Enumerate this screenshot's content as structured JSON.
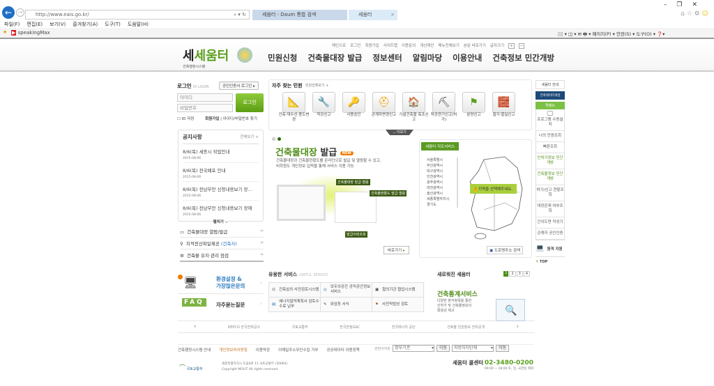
{
  "browser": {
    "url": "http://www.eais.go.kr/",
    "tabs": [
      "세움터 - Daum 통합 검색",
      "세움터"
    ],
    "menu": [
      "파일(F)",
      "편집(E)",
      "보기(V)",
      "즐겨찾기(A)",
      "도구(T)",
      "도움말(H)"
    ],
    "favorite": "speakingMax",
    "toolbar": [
      "페이지(P) ▾",
      "안전(S) ▾",
      "도구(O) ▾"
    ]
  },
  "header": {
    "logo": "세움터",
    "logo_sub": "건축행정시스템",
    "util": [
      "메인으로",
      "로그인",
      "회원가입",
      "사이트맵",
      "이용문의",
      "개선제안",
      "메뉴전체보기",
      "본문 바로가기",
      "글자크기"
    ],
    "nav": [
      "민원신청",
      "건축물대장 발급",
      "정보센터",
      "알림마당",
      "이용안내",
      "건축정보 민간개방"
    ]
  },
  "login": {
    "title": "로그인",
    "title_en": "ID LOGIN",
    "cert": "공인인증서 로그인",
    "id_ph": "아이디",
    "pw_ph": "비밀번호",
    "button": "로그인",
    "save_id": "ID 저장",
    "join": "회원가입",
    "find": "아이디/비밀번호 찾기"
  },
  "notice": {
    "title": "공지사항",
    "more": "전체보기 +",
    "items": [
      {
        "t": "8/6(목) 세종시 작업안내",
        "d": "2015-08-06"
      },
      {
        "t": "8/6(목) 전국배포 안내",
        "d": "2015-08-06"
      },
      {
        "t": "8/6(목) 전남무안 신청내용보기 장…",
        "d": "2015-08-06"
      },
      {
        "t": "8/6(목) 전남무안 신청내용보기 장애",
        "d": "2015-08-06"
      }
    ],
    "expand": "펼치기"
  },
  "quick_links": [
    "건축물대장 열람/발급",
    "지적전산파일제공",
    "건축물 유지·관리 점검"
  ],
  "quick_sub": "(건축사)",
  "promo": [
    {
      "t1": "환경설정 &",
      "t2": "가장많은문의"
    },
    {
      "t1": "자주묻는질문"
    }
  ],
  "frequent": {
    "title": "자주 찾는 민원",
    "more": "민원전체보기 +",
    "items": [
      "건축·대수선·용도변경",
      "착공신고",
      "사용승인",
      "관계자변경신고",
      "가설건축물 축조신고",
      "착공연기신고(허가)",
      "분양신고",
      "철거·멸실신고"
    ],
    "expand": "더보기"
  },
  "banner": {
    "title_g": "건축물대장",
    "title_b": "발급",
    "badge": "NEW",
    "desc1": "건축물대장과 건축물현황도를 온라인으로 발급 및 열람할 수 있고,",
    "desc2": "비회원도 개인정보 입력을 통해 서비스 이용 가능",
    "tags": [
      "건축물대장 발급·열람",
      "건축물현황도 발급·열람",
      "발급이력조회"
    ],
    "go": "바로가기"
  },
  "map": {
    "title": "세움터 지도서비스",
    "regions": [
      "서울특별시",
      "부산광역시",
      "대구광역시",
      "인천광역시",
      "광주광역시",
      "대전광역시",
      "울산광역시",
      "세종특별자치시",
      "경기도"
    ],
    "hint": "지역을 선택해주세요.",
    "road": "도로명주소 검색"
  },
  "side": {
    "title": "세움터 안내",
    "banner": "건축데이터개방",
    "quick": "퀵메뉴",
    "items": [
      "프로그램 수동설치",
      "나의 민원조회",
      "빠른조회",
      "인허가정보 민간개방",
      "건축물정보 민간개방",
      "허가/신고 현황조회",
      "대장존재 여부조회",
      "간이도면 작성기",
      "관계자 공인인증"
    ],
    "remote": "원격 지원",
    "top": "TOP"
  },
  "useful": {
    "title": "유용한 서비스",
    "title_en": "USEFUL SERVICE",
    "items": [
      "건축심의 사전검토시스템",
      "모두의공간 공직공간정보서비스",
      "협의기관 협업시스템",
      "에너지절약계획서 검토수수료 납부",
      "위임장 서식",
      "사전적법성 검토"
    ]
  },
  "partners": [
    "KEPCO 한국전력공사",
    "국토교통부",
    "한국한정GAC",
    "한국에너지 공단",
    "건축물 민원정보 전자공개"
  ],
  "news": {
    "title": "새로워진 세움터",
    "pages": [
      "1",
      "2",
      "3",
      "4"
    ],
    "head": "건축통계서비스",
    "desc": [
      "다양한 분석항목을 통한",
      "인허가 및 건축물정보의",
      "활용성 제고"
    ]
  },
  "footer": {
    "links": [
      "건축행정시스템 안내",
      "개인정보처리방침",
      "이용약관",
      "이메일주소무단수집 거부",
      "공공데이터 이용정책"
    ],
    "related": "관련사이트",
    "sel1": "정부기관",
    "sel2": "지방자치단체",
    "go": "이동",
    "ministry": "국토교통부",
    "address": "세종특별자치시 도움6로 11 국토교통부 (30064)",
    "copyright": "Copyright MOLIT All rights reserved.",
    "call": "세움터 콜센터",
    "phone": "02-3480-0200",
    "hours": "09:00 ~ 18:00 토, 일, 국경일 제외"
  }
}
